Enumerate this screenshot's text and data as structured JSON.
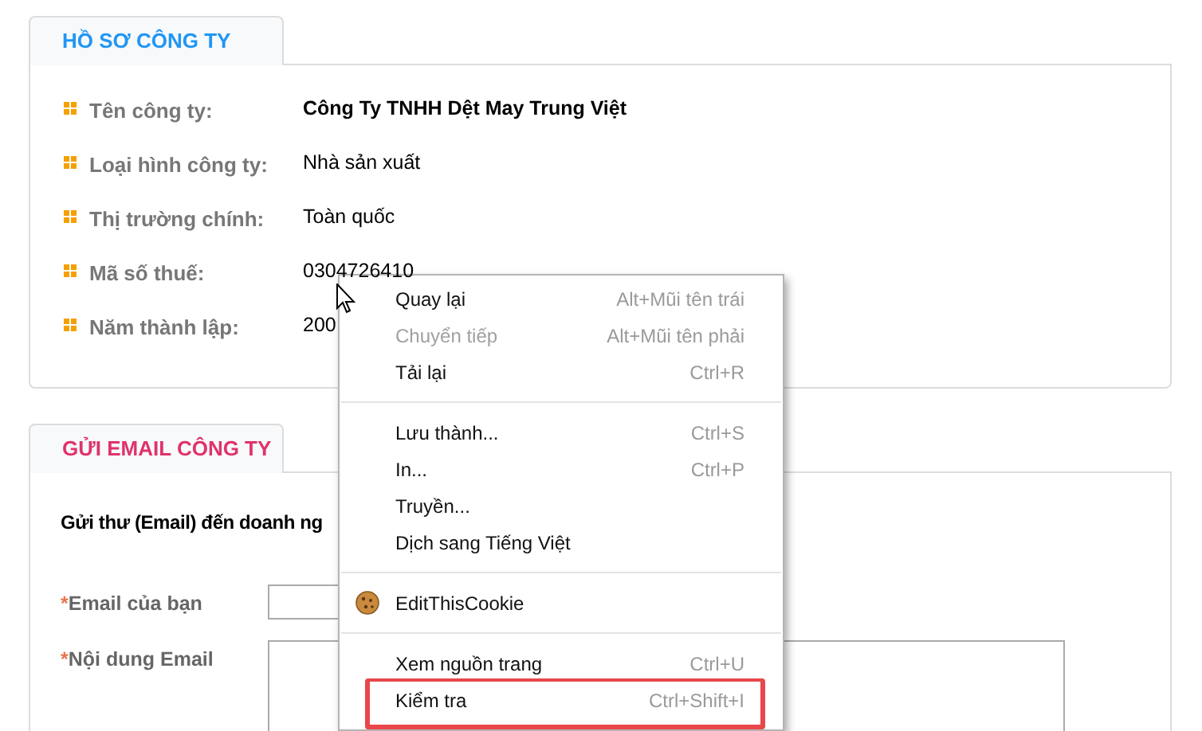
{
  "profile": {
    "title": "HỒ SƠ CÔNG TY",
    "rows": [
      {
        "label": "Tên công ty:",
        "value": "Công Ty TNHH Dệt May Trung Việt",
        "bold": true
      },
      {
        "label": "Loại hình công ty:",
        "value": "Nhà sản xuất",
        "bold": false
      },
      {
        "label": "Thị trường chính:",
        "value": "Toàn quốc",
        "bold": false
      },
      {
        "label": "Mã số thuế:",
        "value": "0304726410",
        "bold": false
      },
      {
        "label": "Năm thành lập:",
        "value": "200",
        "bold": false
      }
    ]
  },
  "email": {
    "title": "GỬI EMAIL CÔNG TY",
    "intro": "Gửi thư (Email) đến doanh ng",
    "fields": [
      {
        "marker": "*",
        "label": "Email của bạn",
        "kind": "input"
      },
      {
        "marker": "*",
        "label": "Nội dung Email",
        "kind": "textarea"
      }
    ]
  },
  "context_menu": {
    "items": [
      {
        "kind": "item",
        "label": "Quay lại",
        "shortcut": "Alt+Mũi tên trái",
        "disabled": false,
        "annotated": false
      },
      {
        "kind": "item",
        "label": "Chuyển tiếp",
        "shortcut": "Alt+Mũi tên phải",
        "disabled": true,
        "annotated": false
      },
      {
        "kind": "item",
        "label": "Tải lại",
        "shortcut": "Ctrl+R",
        "disabled": false,
        "annotated": false
      },
      {
        "kind": "separator"
      },
      {
        "kind": "item",
        "label": "Lưu thành...",
        "shortcut": "Ctrl+S",
        "disabled": false,
        "annotated": false
      },
      {
        "kind": "item",
        "label": "In...",
        "shortcut": "Ctrl+P",
        "disabled": false,
        "annotated": false
      },
      {
        "kind": "item",
        "label": "Truyền...",
        "disabled": false,
        "annotated": false
      },
      {
        "kind": "item",
        "label": "Dịch sang Tiếng Việt",
        "disabled": false,
        "annotated": false
      },
      {
        "kind": "separator"
      },
      {
        "kind": "extension",
        "label": "EditThisCookie",
        "disabled": false,
        "annotated": false
      },
      {
        "kind": "separator"
      },
      {
        "kind": "item",
        "label": "Xem nguồn trang",
        "shortcut": "Ctrl+U",
        "disabled": false,
        "annotated": false
      },
      {
        "kind": "item",
        "label": "Kiểm tra",
        "shortcut": "Ctrl+Shift+I",
        "disabled": false,
        "annotated": true
      }
    ]
  }
}
